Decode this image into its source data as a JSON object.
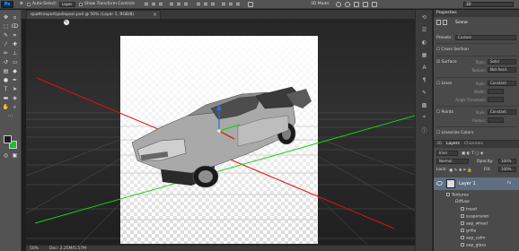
{
  "topbar": {
    "logo": "Ps",
    "auto_select_label": "Auto-Select:",
    "auto_select_value": "Layer",
    "show_transform_label": "Show Transform Controls",
    "mode_3d_label": "3D Mode:",
    "workspace": "3D"
  },
  "document": {
    "tab_title": "quattrosportipoliepoxi.psd @ 50% (Layer 1, RGB/8)",
    "close_glyph": "×"
  },
  "statusbar": {
    "zoom": "50%",
    "doc_info": "Doc: 2.25M/5.57M"
  },
  "properties": {
    "tab_label": "Properties",
    "scene_label": "Scene",
    "presets_label": "Presets:",
    "presets_value": "Custom",
    "cross_section_label": "Cross Section",
    "surface_label": "Surface",
    "surface_style_label": "Style:",
    "surface_style_value": "Solid",
    "texture_label": "Texture:",
    "texture_value": "Not Avail.",
    "lines_label": "Lines",
    "lines_style_label": "Style:",
    "lines_style_value": "Constant",
    "width_label": "Width:",
    "angle_label": "Angle Threshold:",
    "points_label": "Points",
    "points_style_label": "Style:",
    "points_style_value": "Constant",
    "radius_label": "Radius:",
    "linearize_label": "Linearize Colors"
  },
  "layers": {
    "tab_3d": "3D",
    "tab_layers": "Layers",
    "tab_channels": "Channels",
    "kind_label": "Kind",
    "blend_mode": "Normal",
    "opacity_label": "Opacity:",
    "opacity_value": "100%",
    "lock_label": "Lock:",
    "fill_label": "Fill:",
    "fill_value": "100%",
    "layer_name": "Layer 1",
    "fx_label": "fx",
    "textures_label": "Textures",
    "diffuse_label": "Diffuse",
    "textures": [
      "tread",
      "suspension",
      "aap_wheel",
      "grille",
      "aap_calm",
      "aap_glass",
      "aap_gl..."
    ]
  },
  "colors": {
    "background_swatch": "#18c02a",
    "foreground_swatch": "#1a1a1a",
    "axis_red": "#e01010",
    "axis_green": "#18d018",
    "grid_line": "#6a6a6a",
    "selected_layer": "#5f6f82"
  }
}
